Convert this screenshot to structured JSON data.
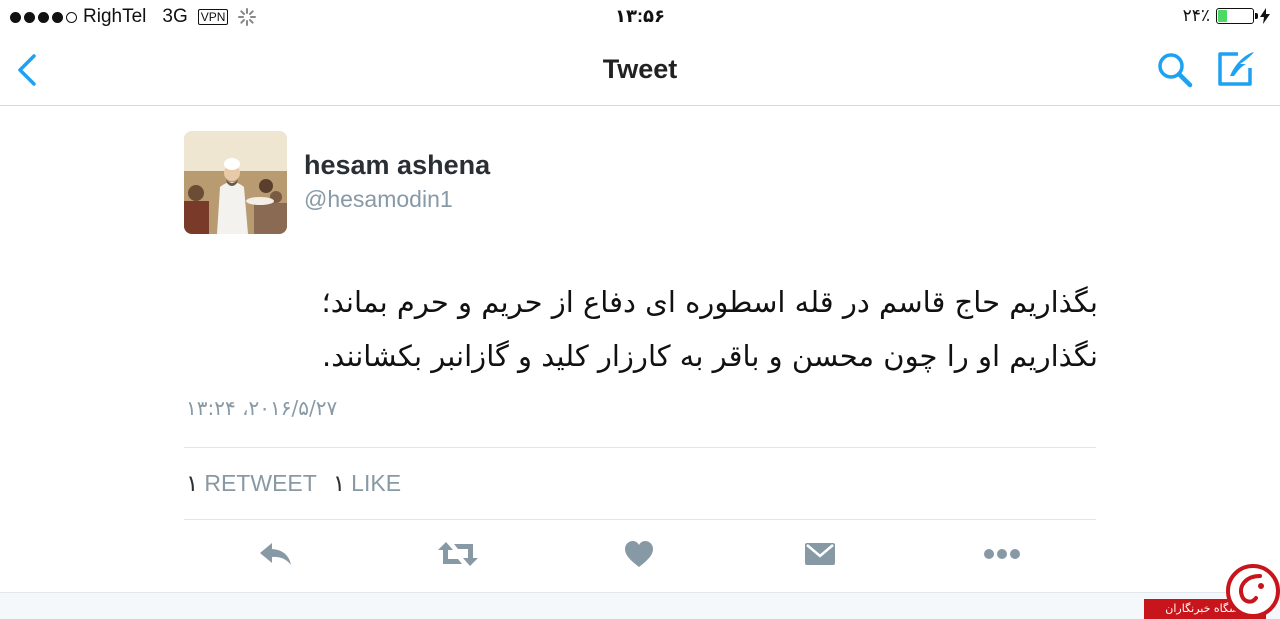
{
  "statusbar": {
    "carrier": "RighTel",
    "network": "3G",
    "vpn": "VPN",
    "time": "۱۳:۵۶",
    "battery_percent": "۲۴٪",
    "battery_level": 0.24,
    "signal_dots_filled": 4,
    "signal_dots_total": 5
  },
  "nav": {
    "title": "Tweet",
    "back_icon": "chevron-left-icon",
    "search_icon": "search-icon",
    "compose_icon": "compose-tweet-icon"
  },
  "tweet": {
    "name": "hesam ashena",
    "handle": "@hesamodin1",
    "text_line1": "بگذاریم حاج قاسم در قله اسطوره ای دفاع از حریم و حرم بماند؛",
    "text_line2": "نگذاریم او را چون محسن و باقر به کارزار کلید و گازانبر بکشانند.",
    "timestamp": "۱۳:۲۴ ،۲۰۱۶/۵/۲۷",
    "retweet_count": "۱",
    "retweet_label": "RETWEET",
    "like_count": "۱",
    "like_label": "LIKE"
  },
  "actions": [
    "reply-icon",
    "retweet-icon",
    "heart-icon",
    "direct-message-icon",
    "more-icon"
  ],
  "colors": {
    "accent": "#1da1f2",
    "action_gray": "#8899a6",
    "watermark_red": "#c8141b",
    "battery_green": "#4cd964"
  },
  "watermark": {
    "text": "باشگاه خبرنگاران"
  }
}
